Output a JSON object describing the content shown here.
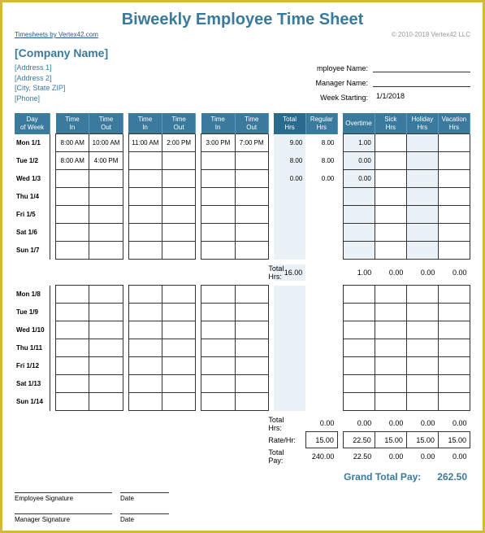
{
  "title": "Biweekly Employee Time Sheet",
  "link_text": "Timesheets by Vertex42.com",
  "copyright": "© 2010-2018 Vertex42 LLC",
  "company": "[Company Name]",
  "address": [
    "[Address 1]",
    "[Address 2]",
    "[City, State  ZIP]",
    "[Phone]"
  ],
  "info": {
    "emp_label": "mployee Name:",
    "emp_val": "",
    "mgr_label": "Manager Name:",
    "mgr_val": "",
    "week_label": "Week Starting:",
    "week_val": "1/1/2018"
  },
  "headers": [
    "Day of Week",
    "Time In",
    "Time Out",
    "Time In",
    "Time Out",
    "Time In",
    "Time Out",
    "Total Hrs",
    "Regular Hrs",
    "Overtime",
    "Sick Hrs",
    "Holiday Hrs",
    "Vacation Hrs"
  ],
  "week1": [
    {
      "day": "Mon 1/1",
      "t": [
        "8:00 AM",
        "10:00 AM",
        "11:00 AM",
        "2:00 PM",
        "3:00 PM",
        "7:00 PM"
      ],
      "tot": "9.00",
      "reg": "8.00",
      "ot": "1.00",
      "sick": "",
      "hol": "",
      "vac": ""
    },
    {
      "day": "Tue 1/2",
      "t": [
        "8:00 AM",
        "4:00 PM",
        "",
        "",
        "",
        ""
      ],
      "tot": "8.00",
      "reg": "8.00",
      "ot": "0.00",
      "sick": "",
      "hol": "",
      "vac": ""
    },
    {
      "day": "Wed 1/3",
      "t": [
        "",
        "",
        "",
        "",
        "",
        ""
      ],
      "tot": "0.00",
      "reg": "0.00",
      "ot": "0.00",
      "sick": "",
      "hol": "",
      "vac": ""
    },
    {
      "day": "Thu 1/4",
      "t": [
        "",
        "",
        "",
        "",
        "",
        ""
      ],
      "tot": "",
      "reg": "",
      "ot": "",
      "sick": "",
      "hol": "",
      "vac": ""
    },
    {
      "day": "Fri 1/5",
      "t": [
        "",
        "",
        "",
        "",
        "",
        ""
      ],
      "tot": "",
      "reg": "",
      "ot": "",
      "sick": "",
      "hol": "",
      "vac": ""
    },
    {
      "day": "Sat 1/6",
      "t": [
        "",
        "",
        "",
        "",
        "",
        ""
      ],
      "tot": "",
      "reg": "",
      "ot": "",
      "sick": "",
      "hol": "",
      "vac": ""
    },
    {
      "day": "Sun 1/7",
      "t": [
        "",
        "",
        "",
        "",
        "",
        ""
      ],
      "tot": "",
      "reg": "",
      "ot": "",
      "sick": "",
      "hol": "",
      "vac": ""
    }
  ],
  "week1_totals": {
    "lbl": "Total Hrs:",
    "tot": "16.00",
    "ot": "1.00",
    "sick": "0.00",
    "hol": "0.00",
    "vac": "0.00"
  },
  "week2": [
    {
      "day": "Mon 1/8",
      "t": [
        "",
        "",
        "",
        "",
        "",
        ""
      ],
      "tot": "",
      "reg": "",
      "ot": "",
      "sick": "",
      "hol": "",
      "vac": ""
    },
    {
      "day": "Tue 1/9",
      "t": [
        "",
        "",
        "",
        "",
        "",
        ""
      ],
      "tot": "",
      "reg": "",
      "ot": "",
      "sick": "",
      "hol": "",
      "vac": ""
    },
    {
      "day": "Wed 1/10",
      "t": [
        "",
        "",
        "",
        "",
        "",
        ""
      ],
      "tot": "",
      "reg": "",
      "ot": "",
      "sick": "",
      "hol": "",
      "vac": ""
    },
    {
      "day": "Thu 1/11",
      "t": [
        "",
        "",
        "",
        "",
        "",
        ""
      ],
      "tot": "",
      "reg": "",
      "ot": "",
      "sick": "",
      "hol": "",
      "vac": ""
    },
    {
      "day": "Fri 1/12",
      "t": [
        "",
        "",
        "",
        "",
        "",
        ""
      ],
      "tot": "",
      "reg": "",
      "ot": "",
      "sick": "",
      "hol": "",
      "vac": ""
    },
    {
      "day": "Sat 1/13",
      "t": [
        "",
        "",
        "",
        "",
        "",
        ""
      ],
      "tot": "",
      "reg": "",
      "ot": "",
      "sick": "",
      "hol": "",
      "vac": ""
    },
    {
      "day": "Sun 1/14",
      "t": [
        "",
        "",
        "",
        "",
        "",
        ""
      ],
      "tot": "",
      "reg": "",
      "ot": "",
      "sick": "",
      "hol": "",
      "vac": ""
    }
  ],
  "week2_totals": {
    "lbl": "Total Hrs:",
    "reg": "0.00",
    "ot": "0.00",
    "sick": "0.00",
    "hol": "0.00",
    "vac": "0.00"
  },
  "rate": {
    "lbl": "Rate/Hr:",
    "reg": "15.00",
    "ot": "22.50",
    "sick": "15.00",
    "hol": "15.00",
    "vac": "15.00"
  },
  "pay": {
    "lbl": "Total Pay:",
    "reg": "240.00",
    "ot": "22.50",
    "sick": "0.00",
    "hol": "0.00",
    "vac": "0.00"
  },
  "grand": {
    "lbl": "Grand Total Pay:",
    "val": "262.50"
  },
  "sig": {
    "emp": "Employee Signature",
    "mgr": "Manager Signature",
    "date": "Date"
  }
}
